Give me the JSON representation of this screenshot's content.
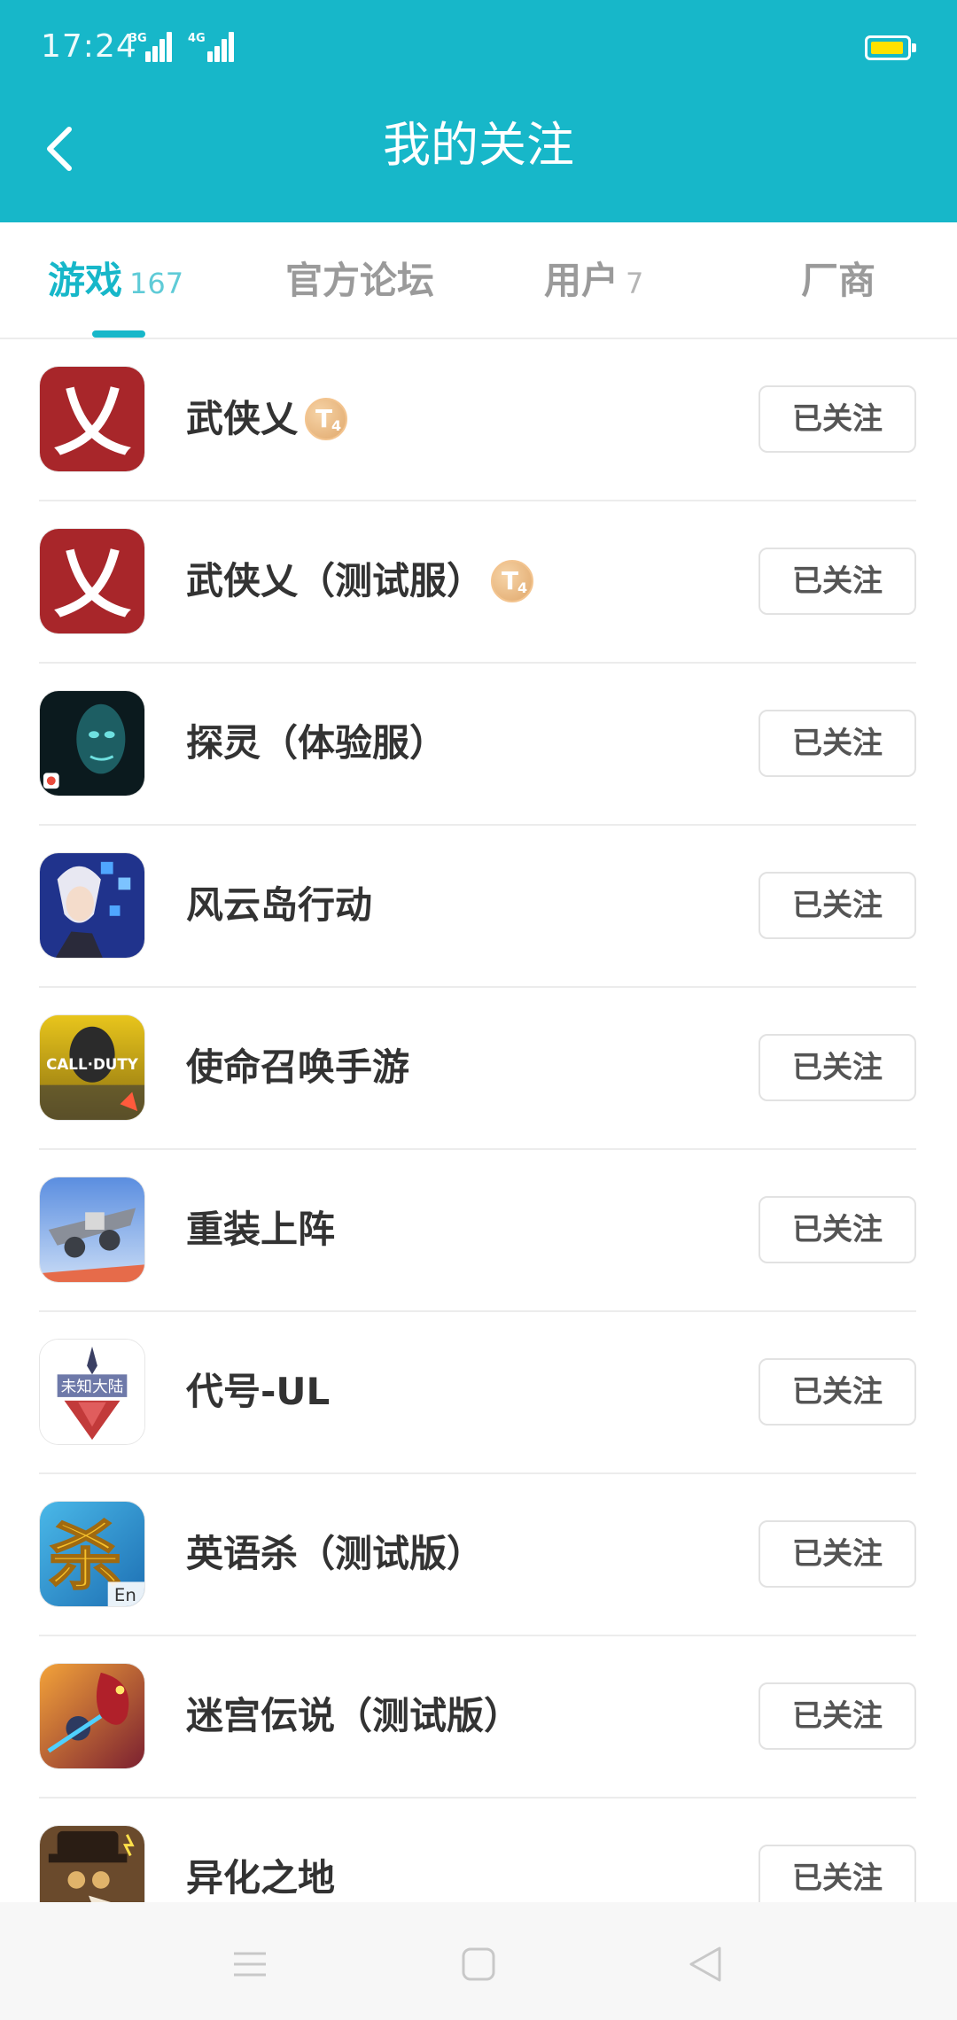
{
  "status": {
    "time": "17:24",
    "net1": "3G",
    "net2": "4G"
  },
  "header": {
    "title": "我的关注"
  },
  "tabs": [
    {
      "label": "游戏",
      "count": "167",
      "active": true
    },
    {
      "label": "官方论坛",
      "count": ""
    },
    {
      "label": "用户",
      "count": "7"
    },
    {
      "label": "厂商",
      "count": ""
    }
  ],
  "games": [
    {
      "name": "武侠乂",
      "badge": true,
      "icon": "wuxia-icon"
    },
    {
      "name": "武侠乂（测试服）",
      "badge": true,
      "icon": "wuxia-icon"
    },
    {
      "name": "探灵（体验服）",
      "icon": "tanling-icon"
    },
    {
      "name": "风云岛行动",
      "icon": "fengyundao-icon"
    },
    {
      "name": "使命召唤手游",
      "icon": "call-of-duty-icon"
    },
    {
      "name": "重装上阵",
      "icon": "zhongzhuang-icon"
    },
    {
      "name": "代号-UL",
      "icon": "daihao-ul-icon"
    },
    {
      "name": "英语杀（测试版）",
      "icon": "yingyusha-icon"
    },
    {
      "name": "迷宫伝说（测试版）",
      "icon": "maze-icon"
    },
    {
      "name": "异化之地",
      "icon": "yihua-icon"
    }
  ],
  "badge": {
    "letter": "T",
    "level": "4"
  },
  "icon_text": {
    "wuxia": "乂",
    "call_of_duty": "CALL·DUTY",
    "daihao": "未知大陆",
    "yingyusha": "杀",
    "yingyusha_en": "En"
  },
  "follow_label": "已关注",
  "colors": {
    "primary": "#17b7c9",
    "text": "#333333",
    "divider": "#ececec"
  }
}
